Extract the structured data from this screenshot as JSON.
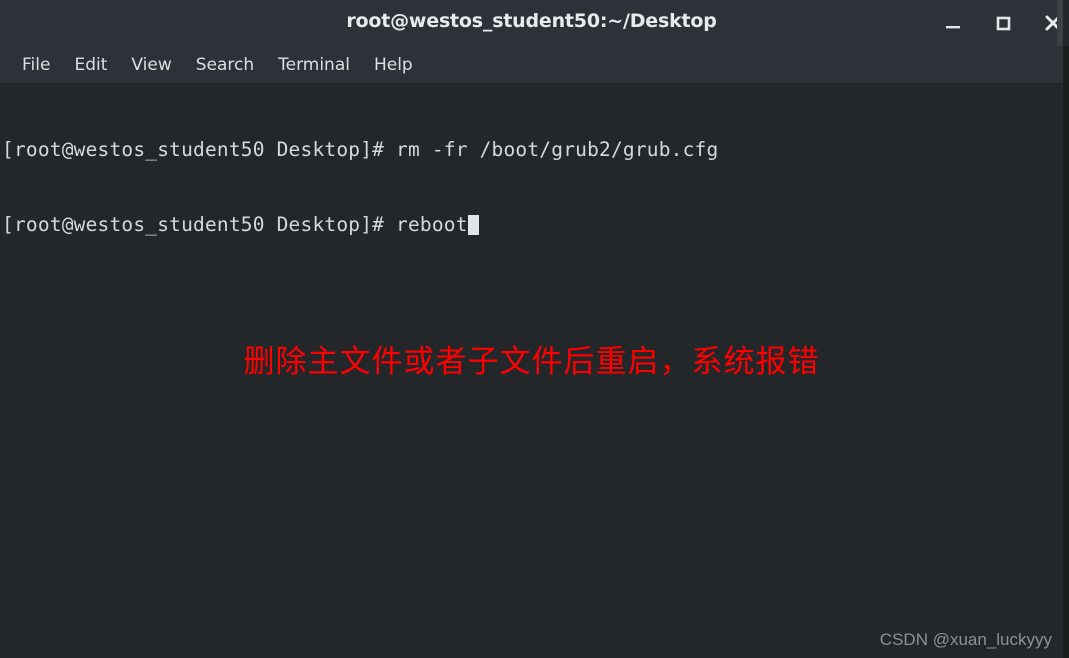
{
  "window": {
    "title": "root@westos_student50:~/Desktop",
    "controls": [
      {
        "name": "minimize",
        "label": "_"
      },
      {
        "name": "maximize",
        "label": "□"
      },
      {
        "name": "close",
        "label": "✕"
      }
    ],
    "titlebar_color": "#2c3237",
    "body_color": "#232729"
  },
  "menubar": {
    "items": [
      {
        "label": "File"
      },
      {
        "label": "Edit"
      },
      {
        "label": "View"
      },
      {
        "label": "Search"
      },
      {
        "label": "Terminal"
      },
      {
        "label": "Help"
      }
    ]
  },
  "terminal": {
    "prompt": "[root@westos_student50 Desktop]# ",
    "lines": [
      {
        "prompt": "[root@westos_student50 Desktop]# ",
        "command": "rm -fr /boot/grub2/grub.cfg",
        "cursor": false
      },
      {
        "prompt": "[root@westos_student50 Desktop]# ",
        "command": "reboot",
        "cursor": true
      }
    ],
    "foreground_color": "#d6d9da",
    "cursor_color": "#e2e5e6"
  },
  "annotation": {
    "text": "删除主文件或者子文件后重启，系统报错",
    "color": "#ff0000"
  },
  "watermark": {
    "text": "CSDN @xuan_luckyyy",
    "color": "#8b9197"
  }
}
